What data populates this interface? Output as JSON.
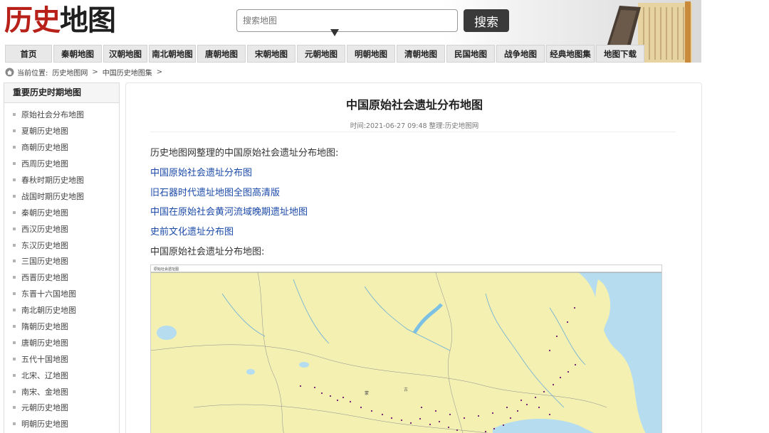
{
  "header": {
    "logo_part1": "历史",
    "logo_part2": "地图",
    "search_placeholder": "搜索地图",
    "search_button": "搜索"
  },
  "nav": {
    "items": [
      "首页",
      "秦朝地图",
      "汉朝地图",
      "南北朝地图",
      "唐朝地图",
      "宋朝地图",
      "元朝地图",
      "明朝地图",
      "清朝地图",
      "民国地图",
      "战争地图",
      "经典地图集",
      "地图下载"
    ]
  },
  "breadcrumb": {
    "prefix": "当前位置:",
    "level1": "历史地图网",
    "level2": "中国历史地图集",
    "sep": ">"
  },
  "sidebar": {
    "title": "重要历史时期地图",
    "items": [
      "原始社会分布地图",
      "夏朝历史地图",
      "商朝历史地图",
      "西周历史地图",
      "春秋时期历史地图",
      "战国时期历史地图",
      "秦朝历史地图",
      "西汉历史地图",
      "东汉历史地图",
      "三国历史地图",
      "西晋历史地图",
      "东晋十六国地图",
      "南北朝历史地图",
      "隋朝历史地图",
      "唐朝历史地图",
      "五代十国地图",
      "北宋、辽地图",
      "南宋、金地图",
      "元朝历史地图",
      "明朝历史地图"
    ]
  },
  "article": {
    "title": "中国原始社会遗址分布地图",
    "meta": "时间:2021-06-27 09:48 整理:历史地图网",
    "intro": "历史地图网整理的中国原始社会遗址分布地图:",
    "links": [
      "中国原始社会遗址分布图",
      "旧石器时代遗址地图全图高清版",
      "中国在原始社会黄河流域晚期遗址地图",
      "史前文化遗址分布图"
    ],
    "caption": "中国原始社会遗址分布地图:"
  },
  "map_labels": {
    "header_text": "原始社会遗址图",
    "region1": "蒙",
    "region2": "古"
  },
  "icons": {
    "home": "home-icon",
    "pin": "map-pin-icon",
    "book": "book-decoration"
  },
  "colors": {
    "logo_red": "#b8211a",
    "link_blue": "#1b4aa8",
    "search_button_bg": "#3a3a3a",
    "nav_bg": "#e8e8e8",
    "map_land": "#f3f0b2",
    "map_sea": "#b5dcef"
  }
}
